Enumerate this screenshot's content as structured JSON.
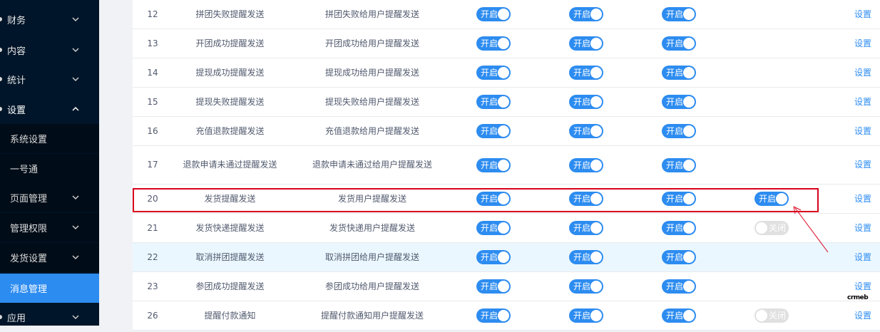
{
  "sidebar": {
    "menu": [
      {
        "label": "财务"
      },
      {
        "label": "内容"
      },
      {
        "label": "统计"
      },
      {
        "label": "设置"
      }
    ],
    "submenu": [
      {
        "label": "系统设置"
      },
      {
        "label": "一号通"
      },
      {
        "label": "页面管理"
      },
      {
        "label": "管理权限"
      },
      {
        "label": "发货设置"
      },
      {
        "label": "消息管理"
      }
    ],
    "bottom": {
      "label": "应用"
    }
  },
  "table": {
    "rows": [
      {
        "id": "12",
        "name": "拼团失败提醒发送",
        "desc": "拼团失败给用户提醒发送",
        "sw1": "开启",
        "sw2": "开启",
        "sw3": "开启",
        "action": "设置"
      },
      {
        "id": "13",
        "name": "开团成功提醒发送",
        "desc": "开团成功给用户提醒发送",
        "sw1": "开启",
        "sw2": "开启",
        "sw3": "开启",
        "action": "设置"
      },
      {
        "id": "14",
        "name": "提现成功提醒发送",
        "desc": "提现成功给用户提醒发送",
        "sw1": "开启",
        "sw2": "开启",
        "sw3": "开启",
        "action": "设置"
      },
      {
        "id": "15",
        "name": "提现失败提醒发送",
        "desc": "提现失败给用户提醒发送",
        "sw1": "开启",
        "sw2": "开启",
        "sw3": "开启",
        "action": "设置"
      },
      {
        "id": "16",
        "name": "充值退款提醒发送",
        "desc": "充值退款给用户提醒发送",
        "sw1": "开启",
        "sw2": "开启",
        "sw3": "开启",
        "action": "设置"
      },
      {
        "id": "17",
        "name": "退款申请未通过提醒发送",
        "desc": "退款申请未通过给用户提醒发送",
        "sw1": "开启",
        "sw2": "开启",
        "sw3": "开启",
        "action": "设置"
      },
      {
        "id": "20",
        "name": "发货提醒发送",
        "desc": "发货用户提醒发送",
        "sw1": "开启",
        "sw2": "开启",
        "sw3": "开启",
        "sw4": "开启",
        "action": "设置"
      },
      {
        "id": "21",
        "name": "发货快递提醒发送",
        "desc": "发货快递用户提醒发送",
        "sw1": "开启",
        "sw2": "开启",
        "sw3": "开启",
        "sw4": "关闭",
        "action": "设置"
      },
      {
        "id": "22",
        "name": "取消拼团提醒发送",
        "desc": "取消拼团给用户提醒发送",
        "sw1": "开启",
        "sw2": "开启",
        "sw3": "开启",
        "action": "设置"
      },
      {
        "id": "23",
        "name": "参团成功提醒发送",
        "desc": "参团成功给用户提醒发送",
        "sw1": "开启",
        "sw2": "开启",
        "sw3": "开启",
        "action": "设置"
      },
      {
        "id": "26",
        "name": "提醒付款通知",
        "desc": "提醒付款通知用户提醒发送",
        "sw1": "开启",
        "sw2": "开启",
        "sw3": "开启",
        "sw4": "关闭",
        "action": "设置"
      }
    ]
  },
  "watermark": "crmeb",
  "colors": {
    "accent": "#2d8cf0",
    "sidebar_bg": "#001529",
    "highlight_border": "#d9001b",
    "row_hover": "#ebf7ff"
  }
}
